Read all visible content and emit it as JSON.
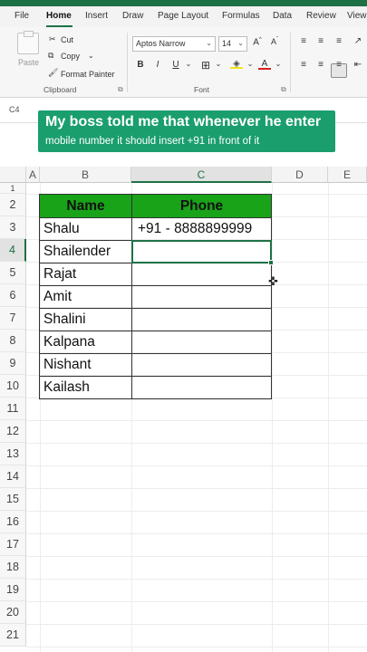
{
  "ribbon": {
    "tabs": [
      "File",
      "Home",
      "Insert",
      "Draw",
      "Page Layout",
      "Formulas",
      "Data",
      "Review",
      "View"
    ],
    "clipboard": {
      "paste_label": "Paste",
      "cut_label": "Cut",
      "copy_label": "Copy",
      "format_painter_label": "Format Painter",
      "group_label": "Clipboard"
    },
    "font": {
      "font_name": "Aptos Narrow",
      "font_size": "14",
      "group_label": "Font"
    }
  },
  "name_box": {
    "value": "C4"
  },
  "caption": {
    "title": "My boss told me that whenever he enter",
    "subtitle": "mobile number it should insert +91 in front of it"
  },
  "sheet": {
    "columns": [
      "A",
      "B",
      "C",
      "D",
      "E"
    ],
    "selected_column": "C",
    "rows": [
      "1",
      "2",
      "3",
      "4",
      "5",
      "6",
      "7",
      "8",
      "9",
      "10",
      "11",
      "12",
      "13",
      "14",
      "15",
      "16",
      "17",
      "18",
      "19",
      "20",
      "21"
    ],
    "selected_row": "4",
    "table": {
      "headers": [
        "Name",
        "Phone"
      ],
      "names": [
        "Shalu",
        "Shailender",
        "Rajat",
        "Amit",
        "Shalini",
        "Kalpana",
        "Nishant",
        "Kailash"
      ],
      "phones": [
        "+91 - 8888899999",
        "",
        "",
        "",
        "",
        "",
        "",
        ""
      ]
    },
    "colors": {
      "header_fill": "#19a319",
      "accent": "#1e7145",
      "caption_bg": "#1a9e6e"
    }
  }
}
